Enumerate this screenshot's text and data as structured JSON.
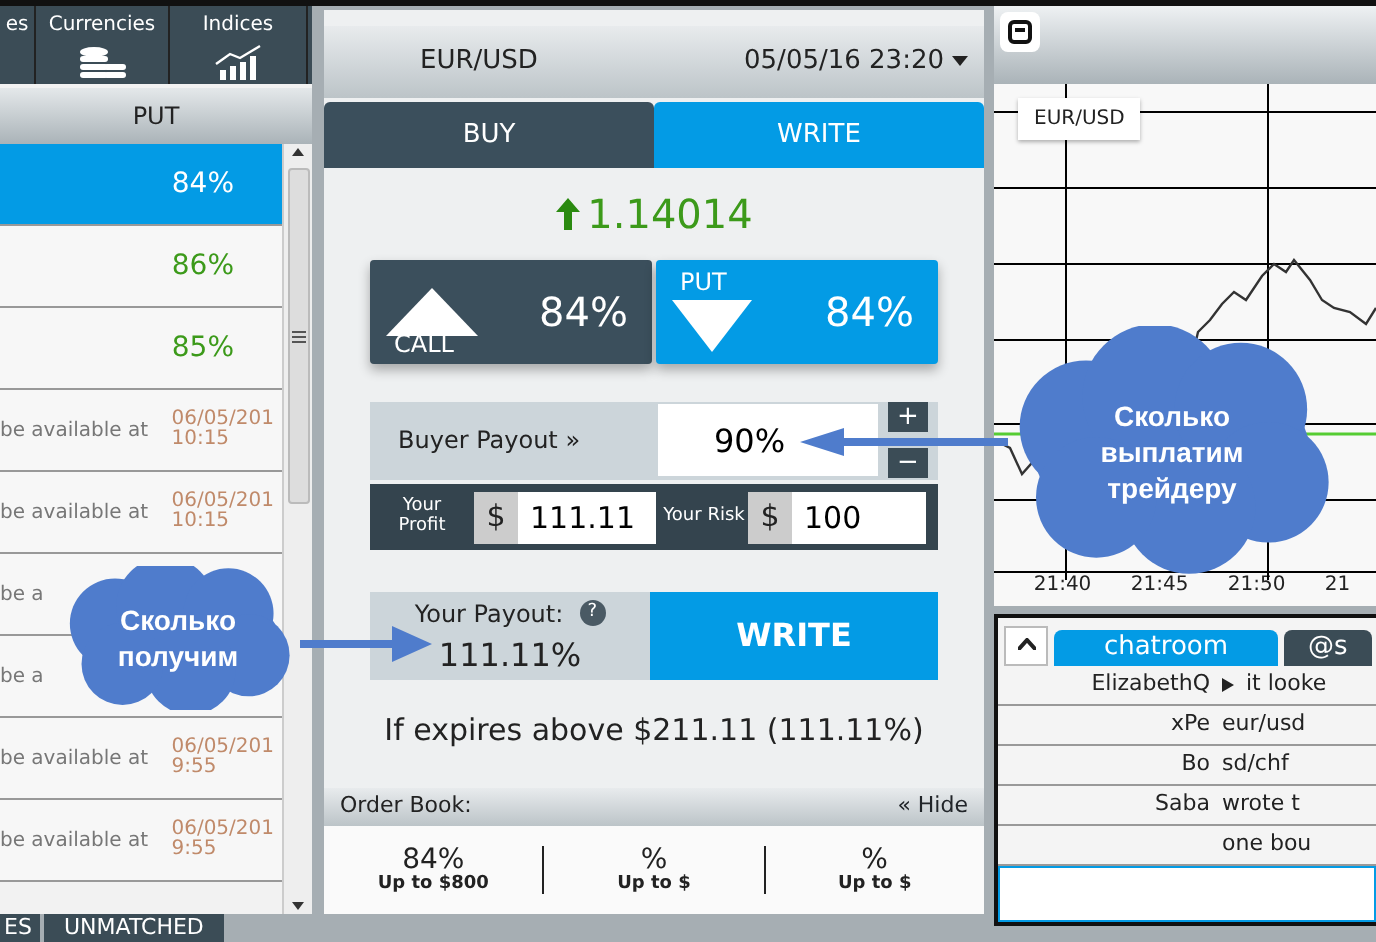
{
  "left_panel": {
    "categories": [
      {
        "label": "es"
      },
      {
        "label": "Currencies"
      },
      {
        "label": "Indices"
      }
    ],
    "column_header": "PUT",
    "rows": [
      {
        "kind": "payout",
        "payout": "84%",
        "selected": true
      },
      {
        "kind": "payout",
        "payout": "86%",
        "selected": false
      },
      {
        "kind": "payout",
        "payout": "85%",
        "selected": false
      },
      {
        "kind": "pending",
        "note": "be available at",
        "date": "06/05/201",
        "time": "10:15",
        "selected": false
      },
      {
        "kind": "pending",
        "note": "be available at",
        "date": "06/05/201",
        "time": "10:15",
        "selected": false
      },
      {
        "kind": "pending",
        "note": "be a",
        "selected": false
      },
      {
        "kind": "pending",
        "note": "be a",
        "selected": false
      },
      {
        "kind": "pending",
        "note": "be available at",
        "date": "06/05/201",
        "time": "9:55",
        "selected": false
      },
      {
        "kind": "pending",
        "note": "be available at",
        "date": "06/05/201",
        "time": "9:55",
        "selected": false
      }
    ],
    "bottom_tabs": [
      "ES",
      "UNMATCHED"
    ]
  },
  "trade_panel": {
    "pair": "EUR/USD",
    "datetime": "05/05/16 23:20",
    "tabs": [
      {
        "label": "BUY",
        "selected": false
      },
      {
        "label": "WRITE",
        "selected": true
      }
    ],
    "price": {
      "value": "1.14014"
    },
    "options": [
      {
        "kind": "call",
        "label": "CALL",
        "payout": "84%",
        "selected": false
      },
      {
        "kind": "put",
        "label": "PUT",
        "payout": "84%",
        "selected": true
      }
    ],
    "buyer_payout": {
      "label": "Buyer Payout »",
      "value": "90%",
      "increase": "+",
      "decrease": "−"
    },
    "profit": {
      "label": "Your Profit",
      "currency": "$",
      "value": "111.11"
    },
    "risk": {
      "label": "Your Risk",
      "currency": "$",
      "value": "100"
    },
    "your_payout": {
      "label": "Your Payout:",
      "help": "?",
      "value": "111.11%"
    },
    "action_button": "WRITE",
    "expiry_note": "If expires above $211.11 (111.11%)",
    "order_book": {
      "title": "Order Book:",
      "hide_link": "« Hide",
      "entries": [
        {
          "percent": "84%",
          "limit": "Up to $800"
        },
        {
          "percent": "%",
          "limit": "Up to $"
        },
        {
          "percent": "%",
          "limit": "Up to $"
        }
      ]
    }
  },
  "chart_panel": {
    "label": "EUR/USD",
    "x_labels": [
      "21:40",
      "21:45",
      "21:50",
      "21"
    ]
  },
  "chat": {
    "tabs": [
      {
        "label": "chatroom",
        "selected": true
      },
      {
        "label": "@s",
        "selected": false
      }
    ],
    "messages": [
      {
        "user": "ElizabethQ",
        "text": "it looke"
      },
      {
        "user": "xPe",
        "text": "eur/usd"
      },
      {
        "user": "Bo",
        "text": "sd/chf"
      },
      {
        "user": "Saba",
        "text": "wrote t"
      },
      {
        "text": "one bou"
      }
    ]
  },
  "callouts": [
    {
      "text": "Сколько получим"
    },
    {
      "text": "Сколько выплатим трейдеру"
    }
  ]
}
